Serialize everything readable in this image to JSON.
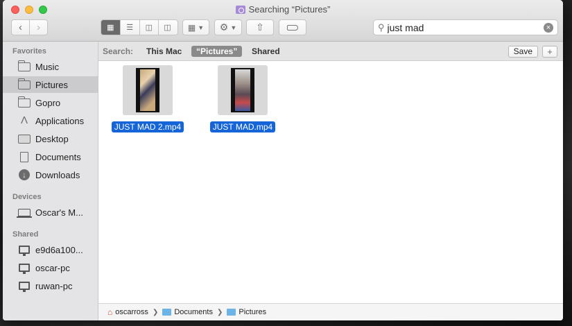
{
  "window": {
    "title": "Searching “Pictures”"
  },
  "toolbar": {
    "back_icon": "chevron-left-icon",
    "forward_icon": "chevron-right-icon",
    "views": [
      "icon-view",
      "list-view",
      "column-view",
      "cover-flow-view"
    ],
    "search": {
      "value": "just mad",
      "placeholder": "Search"
    }
  },
  "sidebar": {
    "favorites_heading": "Favorites",
    "favorites": [
      {
        "label": "Music",
        "icon": "folder-icon"
      },
      {
        "label": "Pictures",
        "icon": "folder-icon",
        "selected": true
      },
      {
        "label": "Gopro",
        "icon": "folder-icon"
      },
      {
        "label": "Applications",
        "icon": "applications-icon"
      },
      {
        "label": "Desktop",
        "icon": "desktop-icon"
      },
      {
        "label": "Documents",
        "icon": "document-icon"
      },
      {
        "label": "Downloads",
        "icon": "download-icon"
      }
    ],
    "devices_heading": "Devices",
    "devices": [
      {
        "label": "Oscar's M...",
        "icon": "laptop-icon"
      }
    ],
    "shared_heading": "Shared",
    "shared": [
      {
        "label": "e9d6a100...",
        "icon": "monitor-icon"
      },
      {
        "label": "oscar-pc",
        "icon": "monitor-icon"
      },
      {
        "label": "ruwan-pc",
        "icon": "monitor-icon"
      }
    ]
  },
  "scope_bar": {
    "label": "Search:",
    "this_mac": "This Mac",
    "pictures": "“Pictures”",
    "shared": "Shared",
    "save_label": "Save",
    "plus_label": "+"
  },
  "files": [
    {
      "name": "JUST MAD 2.mp4"
    },
    {
      "name": "JUST MAD.mp4"
    }
  ],
  "pathbar": {
    "segments": [
      "oscarross",
      "Documents",
      "Pictures"
    ]
  }
}
